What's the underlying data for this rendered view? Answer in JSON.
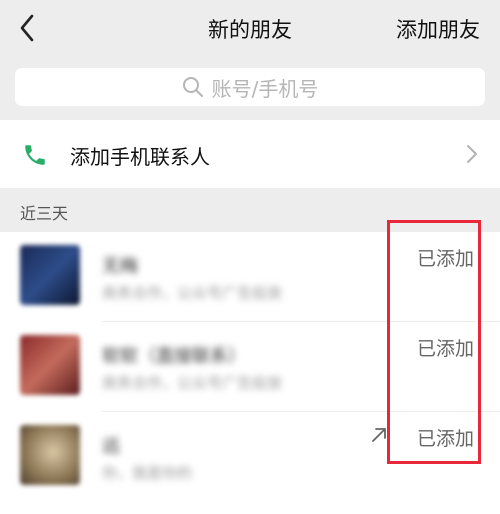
{
  "header": {
    "title": "新的朋友",
    "add_friend": "添加朋友"
  },
  "search": {
    "placeholder": "账号/手机号"
  },
  "add_contacts": {
    "label": "添加手机联系人"
  },
  "section": {
    "recent_label": "近三天"
  },
  "friends": [
    {
      "name": "无梅",
      "subtitle": "商务合作，公众号广告投放",
      "status": "已添加"
    },
    {
      "name": "软软（直接联系）",
      "subtitle": "商务合作，公众号广告投放",
      "status": "已添加"
    },
    {
      "name": "远",
      "subtitle": "你，我是你的",
      "status": "已添加"
    }
  ],
  "colors": {
    "accent_green": "#2aae67",
    "highlight_red": "#e8283a",
    "background": "#ededed"
  }
}
